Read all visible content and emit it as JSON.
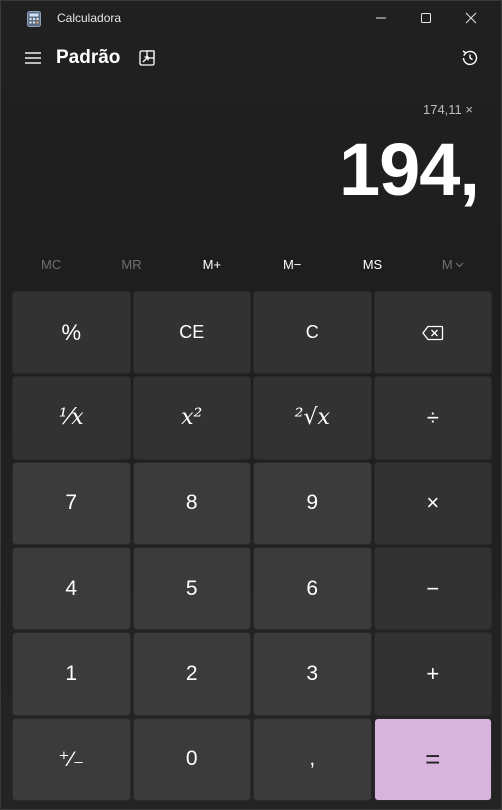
{
  "window": {
    "title": "Calculadora",
    "controls": {
      "minimize": "minimize-icon",
      "maximize": "maximize-icon",
      "close": "close-icon"
    }
  },
  "header": {
    "mode_title": "Padrão",
    "menu_icon": "hamburger-icon",
    "keep_on_top_icon": "keep-on-top-icon",
    "history_icon": "history-icon"
  },
  "display": {
    "expression": "174,11 ×",
    "result": "194,"
  },
  "memory": {
    "mc": "MC",
    "mr": "MR",
    "mplus": "M+",
    "mminus": "M−",
    "ms": "MS",
    "mlist": "M"
  },
  "keys": {
    "percent": "%",
    "ce": "CE",
    "c": "C",
    "backspace": "backspace-icon",
    "reciprocal": "⅟x",
    "square": "x²",
    "sqrt": "²√x",
    "divide": "÷",
    "seven": "7",
    "eight": "8",
    "nine": "9",
    "multiply": "×",
    "four": "4",
    "five": "5",
    "six": "6",
    "minus": "−",
    "one": "1",
    "two": "2",
    "three": "3",
    "plus": "+",
    "negate": "⁺⁄₋",
    "zero": "0",
    "decimal": ",",
    "equals": "="
  },
  "colors": {
    "background": "#202020",
    "key_operator": "#323232",
    "key_number": "#3b3b3b",
    "key_equals": "#d7b4dc",
    "text": "#ffffff",
    "text_disabled": "#6f6f6f"
  }
}
